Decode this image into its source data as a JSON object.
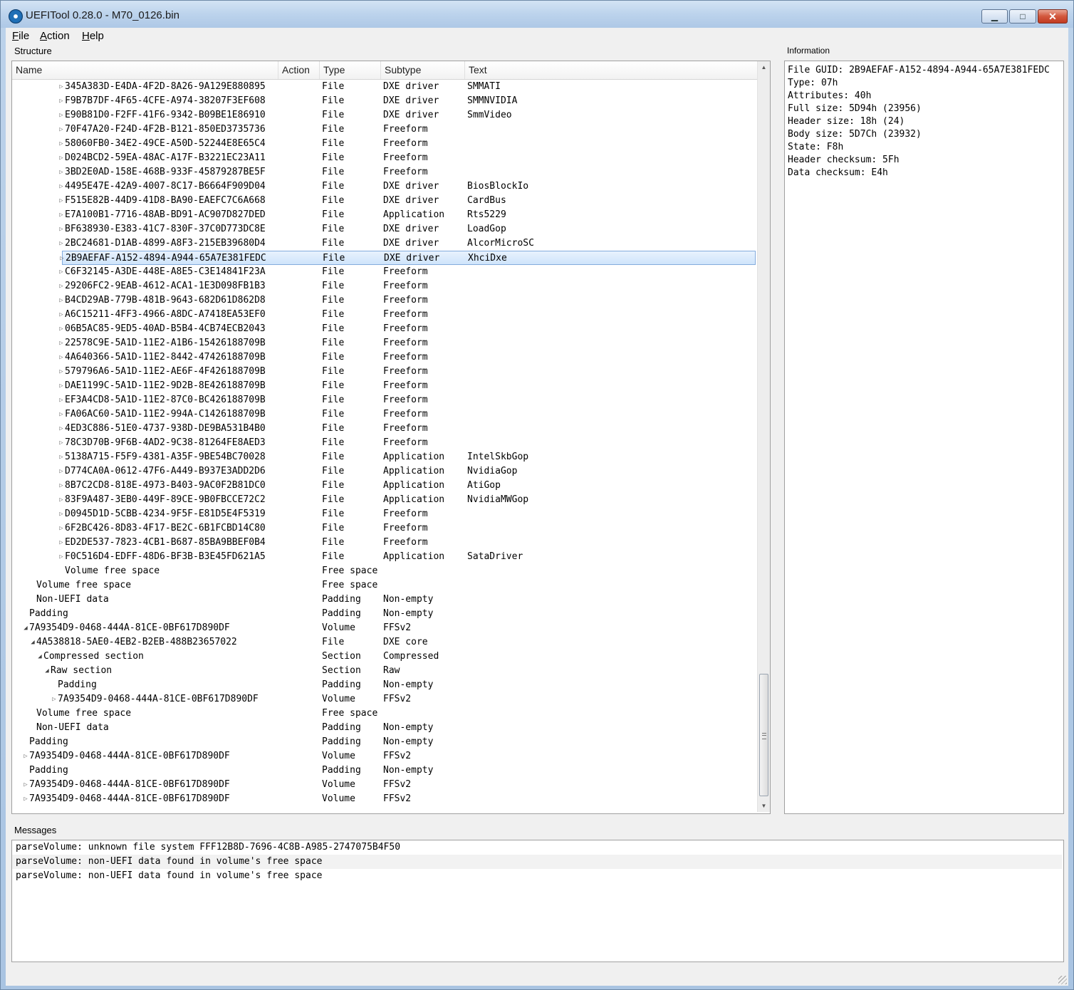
{
  "window": {
    "title": "UEFITool 0.28.0 - M70_0126.bin",
    "minimize_glyph": "▁",
    "maximize_glyph": "□",
    "close_glyph": "✕"
  },
  "menu": [
    {
      "label": "File",
      "accel": "F",
      "rest": "ile"
    },
    {
      "label": "Action",
      "accel": "A",
      "rest": "ction"
    },
    {
      "label": "Help",
      "accel": "H",
      "rest": "elp"
    }
  ],
  "structure": {
    "group_label": "Structure",
    "columns": [
      "Name",
      "Action",
      "Type",
      "Subtype",
      "Text"
    ],
    "rows": [
      {
        "indent": 5,
        "expander": "closed",
        "name": "345A383D-E4DA-4F2D-8A26-9A129E880895",
        "action": "",
        "type": "File",
        "subtype": "DXE driver",
        "text": "SMMATI"
      },
      {
        "indent": 5,
        "expander": "closed",
        "name": "F9B7B7DF-4F65-4CFE-A974-38207F3EF608",
        "action": "",
        "type": "File",
        "subtype": "DXE driver",
        "text": "SMMNVIDIA"
      },
      {
        "indent": 5,
        "expander": "closed",
        "name": "E90B81D0-F2FF-41F6-9342-B09BE1E86910",
        "action": "",
        "type": "File",
        "subtype": "DXE driver",
        "text": "SmmVideo"
      },
      {
        "indent": 5,
        "expander": "closed",
        "name": "70F47A20-F24D-4F2B-B121-850ED3735736",
        "action": "",
        "type": "File",
        "subtype": "Freeform",
        "text": ""
      },
      {
        "indent": 5,
        "expander": "closed",
        "name": "58060FB0-34E2-49CE-A50D-52244E8E65C4",
        "action": "",
        "type": "File",
        "subtype": "Freeform",
        "text": ""
      },
      {
        "indent": 5,
        "expander": "closed",
        "name": "D024BCD2-59EA-48AC-A17F-B3221EC23A11",
        "action": "",
        "type": "File",
        "subtype": "Freeform",
        "text": ""
      },
      {
        "indent": 5,
        "expander": "closed",
        "name": "3BD2E0AD-158E-468B-933F-45879287BE5F",
        "action": "",
        "type": "File",
        "subtype": "Freeform",
        "text": ""
      },
      {
        "indent": 5,
        "expander": "closed",
        "name": "4495E47E-42A9-4007-8C17-B6664F909D04",
        "action": "",
        "type": "File",
        "subtype": "DXE driver",
        "text": "BiosBlockIo"
      },
      {
        "indent": 5,
        "expander": "closed",
        "name": "F515E82B-44D9-41D8-BA90-EAEFC7C6A668",
        "action": "",
        "type": "File",
        "subtype": "DXE driver",
        "text": "CardBus"
      },
      {
        "indent": 5,
        "expander": "closed",
        "name": "E7A100B1-7716-48AB-BD91-AC907D827DED",
        "action": "",
        "type": "File",
        "subtype": "Application",
        "text": "Rts5229"
      },
      {
        "indent": 5,
        "expander": "closed",
        "name": "BF638930-E383-41C7-830F-37C0D773DC8E",
        "action": "",
        "type": "File",
        "subtype": "DXE driver",
        "text": "LoadGop"
      },
      {
        "indent": 5,
        "expander": "closed",
        "name": "2BC24681-D1AB-4899-A8F3-215EB39680D4",
        "action": "",
        "type": "File",
        "subtype": "DXE driver",
        "text": "AlcorMicroSC"
      },
      {
        "indent": 5,
        "expander": "closed",
        "name": "2B9AEFAF-A152-4894-A944-65A7E381FEDC",
        "action": "",
        "type": "File",
        "subtype": "DXE driver",
        "text": "XhciDxe",
        "selected": true
      },
      {
        "indent": 5,
        "expander": "closed",
        "name": "C6F32145-A3DE-448E-A8E5-C3E14841F23A",
        "action": "",
        "type": "File",
        "subtype": "Freeform",
        "text": ""
      },
      {
        "indent": 5,
        "expander": "closed",
        "name": "29206FC2-9EAB-4612-ACA1-1E3D098FB1B3",
        "action": "",
        "type": "File",
        "subtype": "Freeform",
        "text": ""
      },
      {
        "indent": 5,
        "expander": "closed",
        "name": "B4CD29AB-779B-481B-9643-682D61D862D8",
        "action": "",
        "type": "File",
        "subtype": "Freeform",
        "text": ""
      },
      {
        "indent": 5,
        "expander": "closed",
        "name": "A6C15211-4FF3-4966-A8DC-A7418EA53EF0",
        "action": "",
        "type": "File",
        "subtype": "Freeform",
        "text": ""
      },
      {
        "indent": 5,
        "expander": "closed",
        "name": "06B5AC85-9ED5-40AD-B5B4-4CB74ECB2043",
        "action": "",
        "type": "File",
        "subtype": "Freeform",
        "text": ""
      },
      {
        "indent": 5,
        "expander": "closed",
        "name": "22578C9E-5A1D-11E2-A1B6-15426188709B",
        "action": "",
        "type": "File",
        "subtype": "Freeform",
        "text": ""
      },
      {
        "indent": 5,
        "expander": "closed",
        "name": "4A640366-5A1D-11E2-8442-47426188709B",
        "action": "",
        "type": "File",
        "subtype": "Freeform",
        "text": ""
      },
      {
        "indent": 5,
        "expander": "closed",
        "name": "579796A6-5A1D-11E2-AE6F-4F426188709B",
        "action": "",
        "type": "File",
        "subtype": "Freeform",
        "text": ""
      },
      {
        "indent": 5,
        "expander": "closed",
        "name": "DAE1199C-5A1D-11E2-9D2B-8E426188709B",
        "action": "",
        "type": "File",
        "subtype": "Freeform",
        "text": ""
      },
      {
        "indent": 5,
        "expander": "closed",
        "name": "EF3A4CD8-5A1D-11E2-87C0-BC426188709B",
        "action": "",
        "type": "File",
        "subtype": "Freeform",
        "text": ""
      },
      {
        "indent": 5,
        "expander": "closed",
        "name": "FA06AC60-5A1D-11E2-994A-C1426188709B",
        "action": "",
        "type": "File",
        "subtype": "Freeform",
        "text": ""
      },
      {
        "indent": 5,
        "expander": "closed",
        "name": "4ED3C886-51E0-4737-938D-DE9BA531B4B0",
        "action": "",
        "type": "File",
        "subtype": "Freeform",
        "text": ""
      },
      {
        "indent": 5,
        "expander": "closed",
        "name": "78C3D70B-9F6B-4AD2-9C38-81264FE8AED3",
        "action": "",
        "type": "File",
        "subtype": "Freeform",
        "text": ""
      },
      {
        "indent": 5,
        "expander": "closed",
        "name": "5138A715-F5F9-4381-A35F-9BE54BC70028",
        "action": "",
        "type": "File",
        "subtype": "Application",
        "text": "IntelSkbGop"
      },
      {
        "indent": 5,
        "expander": "closed",
        "name": "D774CA0A-0612-47F6-A449-B937E3ADD2D6",
        "action": "",
        "type": "File",
        "subtype": "Application",
        "text": "NvidiaGop"
      },
      {
        "indent": 5,
        "expander": "closed",
        "name": "8B7C2CD8-818E-4973-B403-9AC0F2B81DC0",
        "action": "",
        "type": "File",
        "subtype": "Application",
        "text": "AtiGop"
      },
      {
        "indent": 5,
        "expander": "closed",
        "name": "83F9A487-3EB0-449F-89CE-9B0FBCCE72C2",
        "action": "",
        "type": "File",
        "subtype": "Application",
        "text": "NvidiaMWGop"
      },
      {
        "indent": 5,
        "expander": "closed",
        "name": "D0945D1D-5CBB-4234-9F5F-E81D5E4F5319",
        "action": "",
        "type": "File",
        "subtype": "Freeform",
        "text": ""
      },
      {
        "indent": 5,
        "expander": "closed",
        "name": "6F2BC426-8D83-4F17-BE2C-6B1FCBD14C80",
        "action": "",
        "type": "File",
        "subtype": "Freeform",
        "text": ""
      },
      {
        "indent": 5,
        "expander": "closed",
        "name": "ED2DE537-7823-4CB1-B687-85BA9BBEF0B4",
        "action": "",
        "type": "File",
        "subtype": "Freeform",
        "text": ""
      },
      {
        "indent": 5,
        "expander": "closed",
        "name": "F0C516D4-EDFF-48D6-BF3B-B3E45FD621A5",
        "action": "",
        "type": "File",
        "subtype": "Application",
        "text": "SataDriver"
      },
      {
        "indent": 5,
        "expander": "none",
        "name": "Volume free space",
        "action": "",
        "type": "Free space",
        "subtype": "",
        "text": ""
      },
      {
        "indent": 1,
        "expander": "none",
        "name": "Volume free space",
        "action": "",
        "type": "Free space",
        "subtype": "",
        "text": ""
      },
      {
        "indent": 1,
        "expander": "none",
        "name": "Non-UEFI data",
        "action": "",
        "type": "Padding",
        "subtype": "Non-empty",
        "text": ""
      },
      {
        "indent": 0,
        "expander": "none",
        "name": "Padding",
        "action": "",
        "type": "Padding",
        "subtype": "Non-empty",
        "text": ""
      },
      {
        "indent": 0,
        "expander": "open",
        "name": "7A9354D9-0468-444A-81CE-0BF617D890DF",
        "action": "",
        "type": "Volume",
        "subtype": "FFSv2",
        "text": ""
      },
      {
        "indent": 1,
        "expander": "open",
        "name": "4A538818-5AE0-4EB2-B2EB-488B23657022",
        "action": "",
        "type": "File",
        "subtype": "DXE core",
        "text": ""
      },
      {
        "indent": 2,
        "expander": "open",
        "name": "Compressed section",
        "action": "",
        "type": "Section",
        "subtype": "Compressed",
        "text": ""
      },
      {
        "indent": 3,
        "expander": "open",
        "name": "Raw section",
        "action": "",
        "type": "Section",
        "subtype": "Raw",
        "text": ""
      },
      {
        "indent": 4,
        "expander": "none",
        "name": "Padding",
        "action": "",
        "type": "Padding",
        "subtype": "Non-empty",
        "text": ""
      },
      {
        "indent": 4,
        "expander": "closed",
        "name": "7A9354D9-0468-444A-81CE-0BF617D890DF",
        "action": "",
        "type": "Volume",
        "subtype": "FFSv2",
        "text": ""
      },
      {
        "indent": 1,
        "expander": "none",
        "name": "Volume free space",
        "action": "",
        "type": "Free space",
        "subtype": "",
        "text": ""
      },
      {
        "indent": 1,
        "expander": "none",
        "name": "Non-UEFI data",
        "action": "",
        "type": "Padding",
        "subtype": "Non-empty",
        "text": ""
      },
      {
        "indent": 0,
        "expander": "none",
        "name": "Padding",
        "action": "",
        "type": "Padding",
        "subtype": "Non-empty",
        "text": ""
      },
      {
        "indent": 0,
        "expander": "closed",
        "name": "7A9354D9-0468-444A-81CE-0BF617D890DF",
        "action": "",
        "type": "Volume",
        "subtype": "FFSv2",
        "text": ""
      },
      {
        "indent": 0,
        "expander": "none",
        "name": "Padding",
        "action": "",
        "type": "Padding",
        "subtype": "Non-empty",
        "text": ""
      },
      {
        "indent": 0,
        "expander": "closed",
        "name": "7A9354D9-0468-444A-81CE-0BF617D890DF",
        "action": "",
        "type": "Volume",
        "subtype": "FFSv2",
        "text": ""
      },
      {
        "indent": 0,
        "expander": "closed",
        "name": "7A9354D9-0468-444A-81CE-0BF617D890DF",
        "action": "",
        "type": "Volume",
        "subtype": "FFSv2",
        "text": ""
      }
    ]
  },
  "information": {
    "group_label": "Information",
    "lines": [
      "File GUID: 2B9AEFAF-A152-4894-A944-65A7E381FEDC",
      "Type: 07h",
      "Attributes: 40h",
      "Full size: 5D94h (23956)",
      "Header size: 18h (24)",
      "Body size: 5D7Ch (23932)",
      "State: F8h",
      "Header checksum: 5Fh",
      "Data checksum: E4h"
    ]
  },
  "messages": {
    "group_label": "Messages",
    "lines": [
      "parseVolume: unknown file system FFF12B8D-7696-4C8B-A985-2747075B4F50",
      "parseVolume: non-UEFI data found in volume's free space",
      "parseVolume: non-UEFI data found in volume's free space"
    ]
  },
  "icons": {
    "expander_closed": "▷",
    "expander_open": "◢",
    "scroll_up": "▲",
    "scroll_down": "▼"
  }
}
